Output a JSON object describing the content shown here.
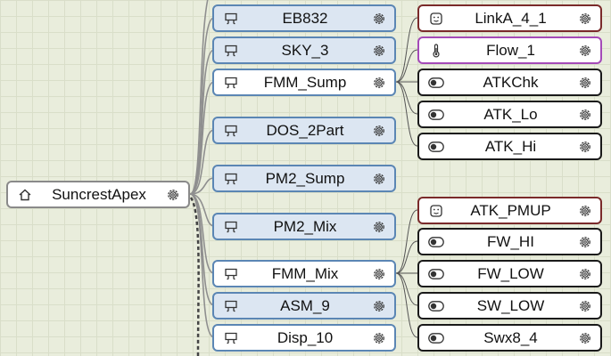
{
  "root": {
    "label": "SuncrestApex",
    "icon": "home-icon"
  },
  "outputs": [
    {
      "label": "EB832",
      "icon": "outlet-icon",
      "style": "blue"
    },
    {
      "label": "SKY_3",
      "icon": "outlet-icon",
      "style": "blue"
    },
    {
      "label": "FMM_Sump",
      "icon": "outlet-icon",
      "style": "white"
    },
    {
      "label": "DOS_2Part",
      "icon": "outlet-icon",
      "style": "blue"
    },
    {
      "label": "PM2_Sump",
      "icon": "outlet-icon",
      "style": "blue"
    },
    {
      "label": "PM2_Mix",
      "icon": "outlet-icon",
      "style": "blue"
    },
    {
      "label": "FMM_Mix",
      "icon": "outlet-icon",
      "style": "white"
    },
    {
      "label": "ASM_9",
      "icon": "outlet-icon",
      "style": "blue"
    },
    {
      "label": "Disp_10",
      "icon": "outlet-icon",
      "style": "white"
    }
  ],
  "inputs": [
    {
      "label": "LinkA_4_1",
      "icon": "socket-icon",
      "border": "#7a2a2a"
    },
    {
      "label": "Flow_1",
      "icon": "thermometer-icon",
      "border": "#a44ab8"
    },
    {
      "label": "ATKChk",
      "icon": "toggle-icon",
      "border": "#1a1a1a"
    },
    {
      "label": "ATK_Lo",
      "icon": "toggle-icon",
      "border": "#1a1a1a"
    },
    {
      "label": "ATK_Hi",
      "icon": "toggle-icon",
      "border": "#1a1a1a"
    },
    {
      "label": "ATK_PMUP",
      "icon": "socket-icon",
      "border": "#7a2a2a"
    },
    {
      "label": "FW_HI",
      "icon": "toggle-icon",
      "border": "#1a1a1a"
    },
    {
      "label": "FW_LOW",
      "icon": "toggle-icon",
      "border": "#1a1a1a"
    },
    {
      "label": "SW_LOW",
      "icon": "toggle-icon",
      "border": "#1a1a1a"
    },
    {
      "label": "Swx8_4",
      "icon": "toggle-icon",
      "border": "#1a1a1a"
    }
  ],
  "colors": {
    "background": "#e9eddc",
    "output_border": "#5b86b4",
    "output_fill": "#dce6f2",
    "wire": "#888888"
  }
}
